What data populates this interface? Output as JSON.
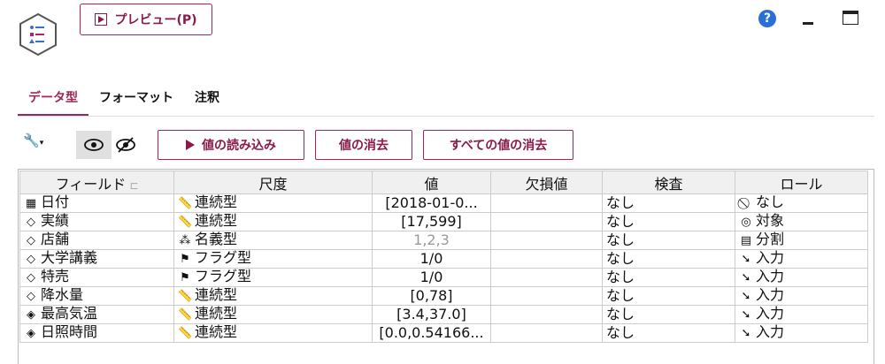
{
  "toolbar": {
    "preview_label": "プレビュー(P)"
  },
  "tabs": [
    {
      "label": "データ型",
      "active": true
    },
    {
      "label": "フォーマット",
      "active": false
    },
    {
      "label": "注釈",
      "active": false
    }
  ],
  "actions": {
    "read_values": "値の読み込み",
    "clear_values": "値の消去",
    "clear_all_values": "すべての値の消去"
  },
  "table": {
    "columns": [
      "フィールド",
      "尺度",
      "値",
      "欠損値",
      "検査",
      "ロール"
    ],
    "rows": [
      {
        "field": "日付",
        "field_icon": "calendar-icon",
        "measure": "連続型",
        "measure_icon": "ruler-icon",
        "value": "[2018-01-0...",
        "missing": "",
        "check": "なし",
        "role": "なし",
        "role_icon": "none-icon"
      },
      {
        "field": "実績",
        "field_icon": "diamond-icon",
        "measure": "連続型",
        "measure_icon": "ruler-icon",
        "value": "[17,599]",
        "missing": "",
        "check": "なし",
        "role": "対象",
        "role_icon": "target-icon"
      },
      {
        "field": "店舗",
        "field_icon": "diamond-icon",
        "measure": "名義型",
        "measure_icon": "nominal-icon",
        "value": "1,2,3",
        "missing": "",
        "check": "なし",
        "role": "分割",
        "role_icon": "split-icon",
        "value_gray": true
      },
      {
        "field": "大学講義",
        "field_icon": "diamond-icon",
        "measure": "フラグ型",
        "measure_icon": "flag-icon",
        "value": "1/0",
        "missing": "",
        "check": "なし",
        "role": "入力",
        "role_icon": "input-arrow-icon"
      },
      {
        "field": "特売",
        "field_icon": "diamond-icon",
        "measure": "フラグ型",
        "measure_icon": "flag-icon",
        "value": "1/0",
        "missing": "",
        "check": "なし",
        "role": "入力",
        "role_icon": "input-arrow-icon"
      },
      {
        "field": "降水量",
        "field_icon": "diamond-icon",
        "measure": "連続型",
        "measure_icon": "ruler-icon",
        "value": "[0,78]",
        "missing": "",
        "check": "なし",
        "role": "入力",
        "role_icon": "input-arrow-icon"
      },
      {
        "field": "最高気温",
        "field_icon": "derived-diamond-icon",
        "measure": "連続型",
        "measure_icon": "ruler-icon",
        "value": "[3.4,37.0]",
        "missing": "",
        "check": "なし",
        "role": "入力",
        "role_icon": "input-arrow-icon"
      },
      {
        "field": "日照時間",
        "field_icon": "derived-diamond-icon",
        "measure": "連続型",
        "measure_icon": "ruler-icon",
        "value": "[0.0,0.54166...",
        "missing": "",
        "check": "なし",
        "role": "入力",
        "role_icon": "input-arrow-icon"
      }
    ]
  }
}
